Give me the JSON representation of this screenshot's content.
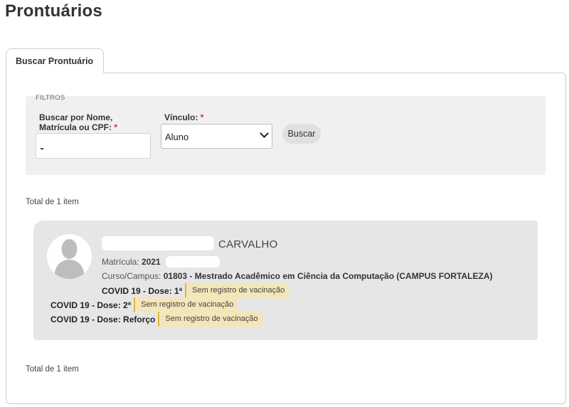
{
  "page": {
    "title": "Prontuários"
  },
  "tabs": [
    {
      "label": "Buscar Prontuário"
    }
  ],
  "filters": {
    "legend": "FILTROS",
    "search": {
      "label": "Buscar por Nome, Matrícula ou CPF:",
      "required_mark": "*",
      "value": ""
    },
    "vinculo": {
      "label": "Vínculo:",
      "required_mark": "*",
      "selected": "Aluno"
    },
    "search_button": "Buscar"
  },
  "results": {
    "total_top": "Total de 1 item",
    "total_bottom": "Total de 1 item",
    "record": {
      "name_visible": "CARVALHO",
      "matricula_label": "Matrícula:",
      "matricula_value": "2021",
      "curso_label": "Curso/Campus:",
      "curso_value": "01803 - Mestrado Acadêmico em Ciência da Computação (CAMPUS FORTALEZA)",
      "vaccinations": [
        {
          "label": "COVID 19 - Dose: 1ª",
          "status": "Sem registro de vacinação"
        },
        {
          "label": "COVID 19 - Dose: 2ª",
          "status": "Sem registro de vacinação"
        },
        {
          "label": "COVID 19 - Dose: Reforço",
          "status": "Sem registro de vacinação"
        }
      ]
    }
  },
  "colors": {
    "status_bg": "#f3e6b8",
    "status_border": "#e0b83c",
    "card_bg": "#e6e6e6",
    "required": "#e02424"
  }
}
